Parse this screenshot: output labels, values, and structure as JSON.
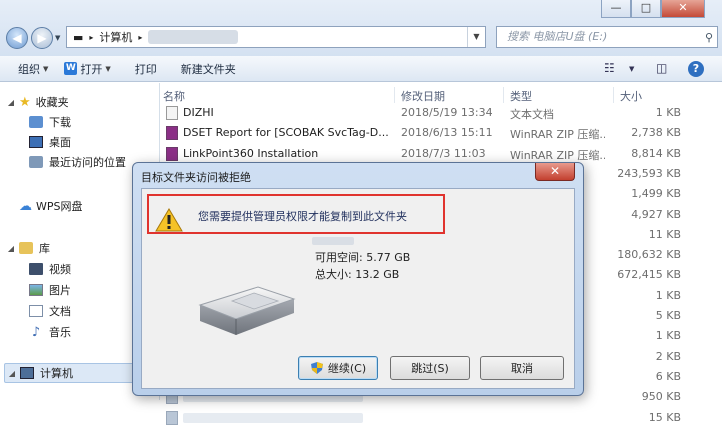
{
  "window_controls": [
    "—",
    "□",
    "✕"
  ],
  "address_bar": {
    "segments": [
      "▬",
      "计算机",
      "▸"
    ],
    "dropdown_icon": "chevron-down-icon",
    "search_placeholder": "搜索 电脑店U盘 (E:)"
  },
  "toolbar": {
    "organize": "组织",
    "open": "打开",
    "print": "打印",
    "new_folder": "新建文件夹"
  },
  "sidebar": {
    "favorites": "收藏夹",
    "downloads": "下载",
    "desktop": "桌面",
    "recent": "最近访问的位置",
    "wps": "WPS网盘",
    "libraries": "库",
    "videos": "视频",
    "pictures": "图片",
    "documents": "文档",
    "music": "音乐",
    "computer": "计算机"
  },
  "columns": {
    "name": "名称",
    "modified": "修改日期",
    "type": "类型",
    "size": "大小"
  },
  "files": [
    {
      "name": "DIZHI",
      "date": "2018/5/19 13:34",
      "type": "文本文档",
      "size": "1 KB"
    },
    {
      "name": "DSET Report for [SCOBAK SvcTag-D...",
      "date": "2018/6/13 15:11",
      "type": "WinRAR ZIP 压缩...",
      "size": "2,738 KB"
    },
    {
      "name": "LinkPoint360 Installation",
      "date": "2018/7/3 11:03",
      "type": "WinRAR ZIP 压缩...",
      "size": "8,814 KB"
    },
    {
      "name": "",
      "date": "",
      "type": "",
      "size": "243,593 KB"
    },
    {
      "name": "",
      "date": "",
      "type": "",
      "size": "1,499 KB"
    },
    {
      "name": "",
      "date": "",
      "type": "",
      "size": "4,927 KB"
    },
    {
      "name": "",
      "date": "",
      "type": "",
      "size": "11 KB"
    },
    {
      "name": "",
      "date": "",
      "type": "",
      "size": "180,632 KB"
    },
    {
      "name": "",
      "date": "",
      "type": "",
      "size": "672,415 KB"
    },
    {
      "name": "",
      "date": "",
      "type": "",
      "size": "1 KB"
    },
    {
      "name": "",
      "date": "",
      "type": "",
      "size": "5 KB"
    },
    {
      "name": "",
      "date": "",
      "type": "",
      "size": "1 KB"
    },
    {
      "name": "",
      "date": "",
      "type": "",
      "size": "2 KB"
    },
    {
      "name": "",
      "date": "",
      "type": "",
      "size": "6 KB"
    },
    {
      "name": "",
      "date": "",
      "type": "",
      "size": "950 KB"
    },
    {
      "name": "",
      "date": "",
      "type": "",
      "size": "15 KB"
    }
  ],
  "dialog": {
    "title": "目标文件夹访问被拒绝",
    "close": "✕",
    "message": "您需要提供管理员权限才能复制到此文件夹",
    "free_space": "可用空间: 5.77 GB",
    "total_size": "总大小: 13.2 GB",
    "continue": "继续(C)",
    "skip": "跳过(S)",
    "cancel": "取消"
  },
  "colors": {
    "highlight_border": "#e0332e",
    "window_frame": "#b9cfea"
  }
}
